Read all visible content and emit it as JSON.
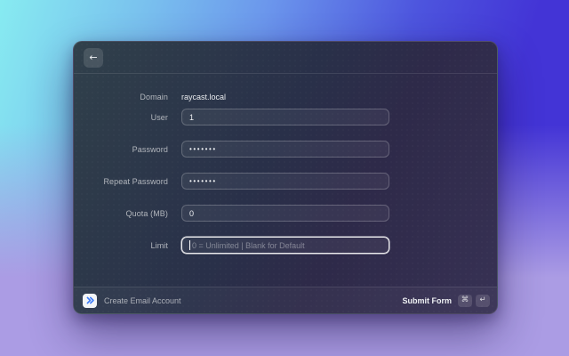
{
  "window": {
    "header": {
      "back_icon": "←"
    },
    "form": {
      "fields": [
        {
          "label": "Domain",
          "type": "static",
          "value": "raycast.local"
        },
        {
          "label": "User",
          "type": "text",
          "value": "1"
        },
        {
          "label": "Password",
          "type": "password",
          "value": "•••••••"
        },
        {
          "label": "Repeat Password",
          "type": "password",
          "value": "•••••••"
        },
        {
          "label": "Quota (MB)",
          "type": "text",
          "value": "0"
        },
        {
          "label": "Limit",
          "type": "text",
          "value": "",
          "placeholder": "0 = Unlimited | Blank for Default",
          "focused": true
        }
      ]
    },
    "footer": {
      "extension_icon": "double-chevron-icon",
      "command_name": "Create Email Account",
      "action_label": "Submit Form",
      "shortcut_keys": [
        "⌘",
        "↵"
      ]
    }
  },
  "colors": {
    "desktop_gradient": [
      "#87ebf1",
      "#6b96ec",
      "#4334d6",
      "#ab9ce4"
    ],
    "window_gradient": [
      "#30404b",
      "#293049",
      "#373154"
    ],
    "focus_border": "#ffffff",
    "extension_icon_blue": "#3b7af7"
  }
}
